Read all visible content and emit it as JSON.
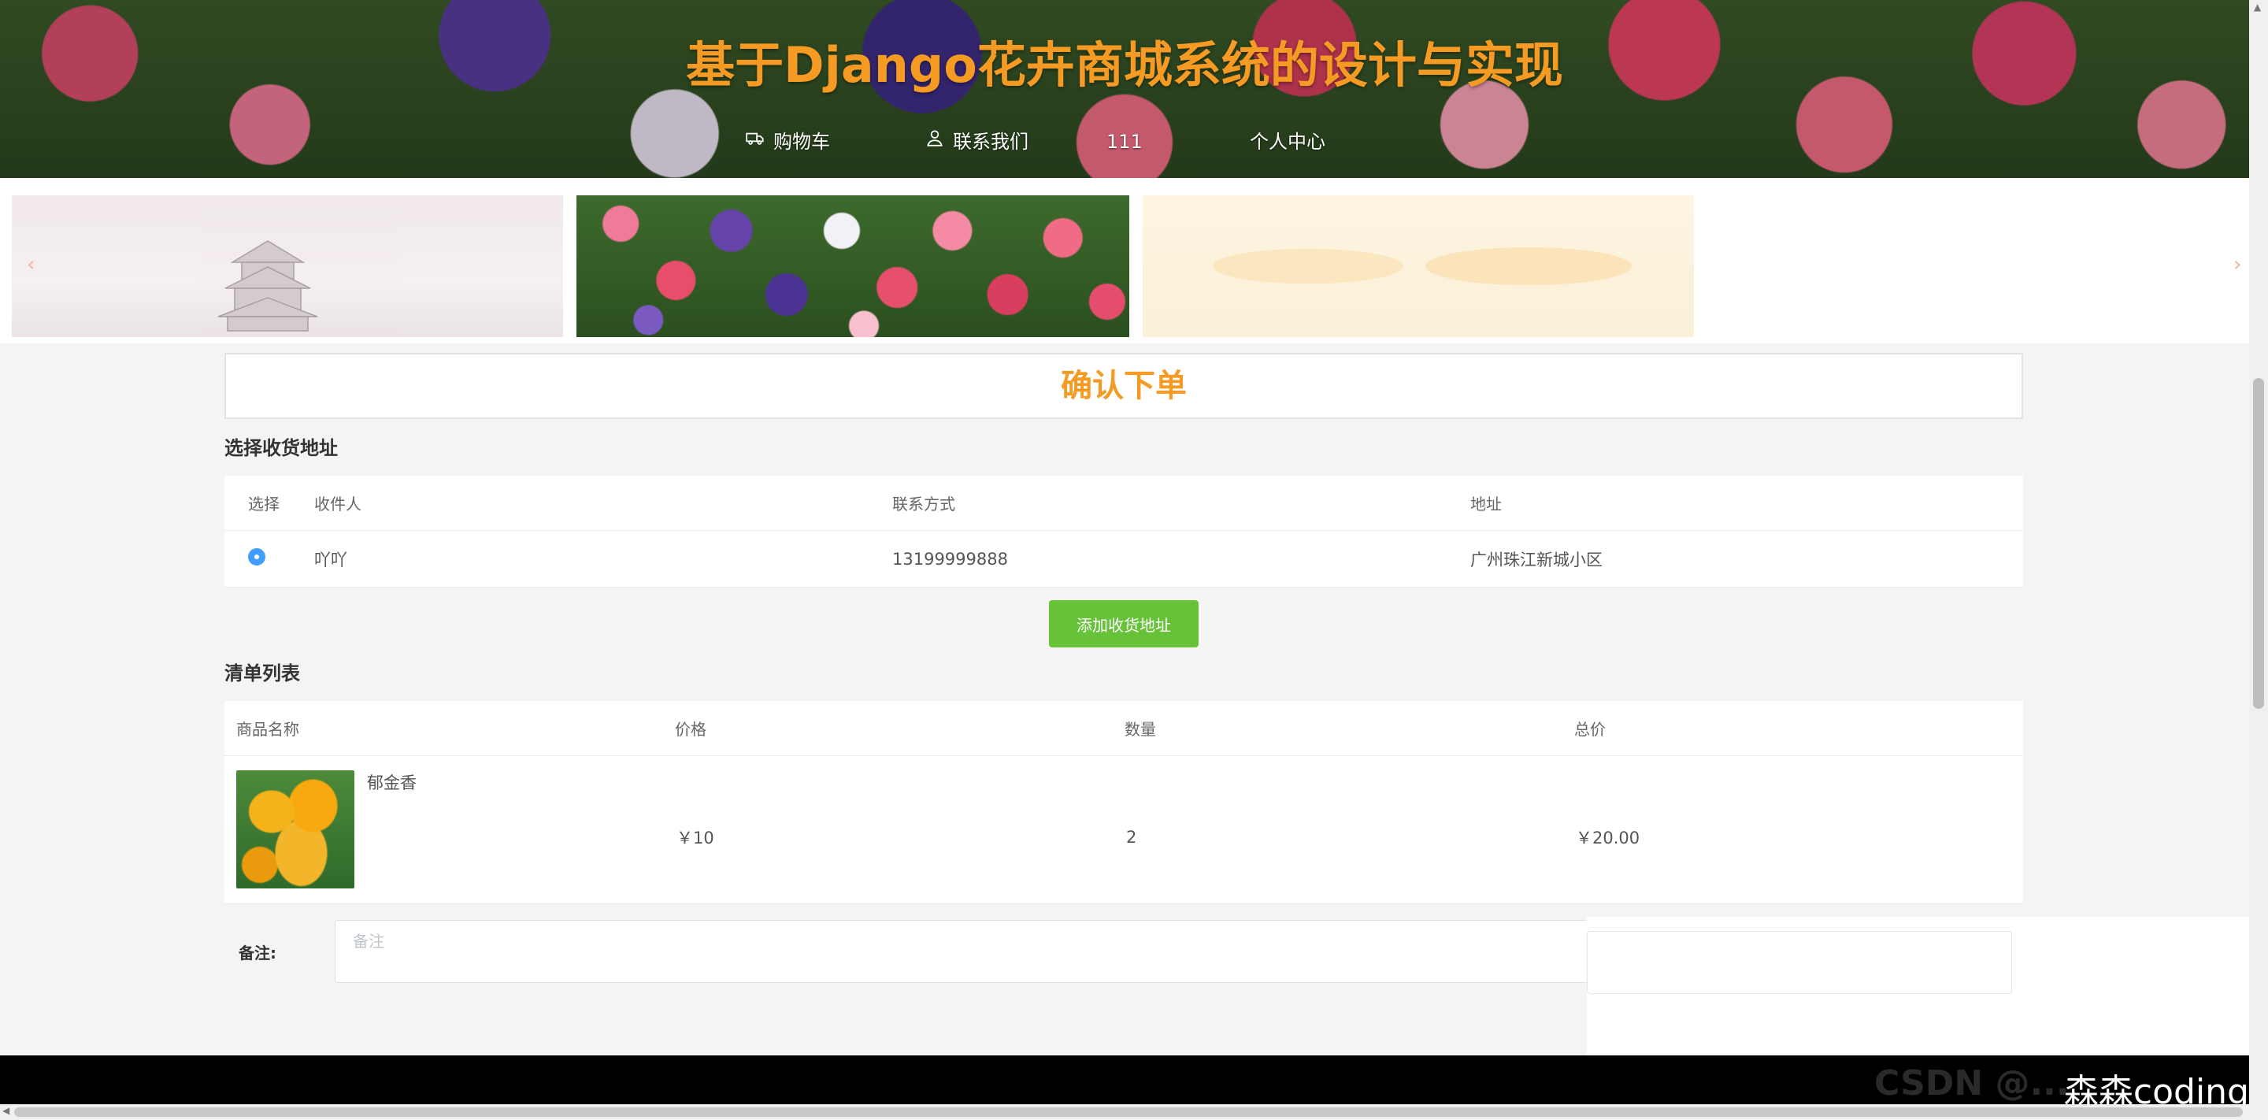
{
  "header": {
    "title": "基于Django花卉商城系统的设计与实现",
    "nav": [
      {
        "label": "购物车",
        "icon": "truck-icon"
      },
      {
        "label": "联系我们",
        "icon": "user-icon"
      },
      {
        "label": "111"
      },
      {
        "label": "个人中心"
      }
    ]
  },
  "carousel": {
    "prev_arrow": "‹",
    "next_arrow": "›"
  },
  "order": {
    "confirm_title": "确认下单",
    "address_section_title": "选择收货地址",
    "address_table": {
      "headers": [
        "选择",
        "收件人",
        "联系方式",
        "地址"
      ],
      "rows": [
        {
          "selected": true,
          "recipient": "吖吖",
          "phone": "13199999888",
          "address": "广州珠江新城小区"
        }
      ]
    },
    "add_address_button": "添加收货地址",
    "goods_section_title": "清单列表",
    "goods_table": {
      "headers": [
        "商品名称",
        "价格",
        "数量",
        "总价"
      ],
      "rows": [
        {
          "name": "郁金香",
          "price": "￥10",
          "quantity": "2",
          "total": "￥20.00"
        }
      ]
    },
    "remark_label": "备注:",
    "remark_placeholder": "备注"
  },
  "footer": {
    "watermark": "森森coding",
    "faint_text": "CSDN @..."
  },
  "colors": {
    "accent_orange": "#f59a23",
    "button_green": "#67c23a",
    "radio_blue": "#409eff"
  }
}
